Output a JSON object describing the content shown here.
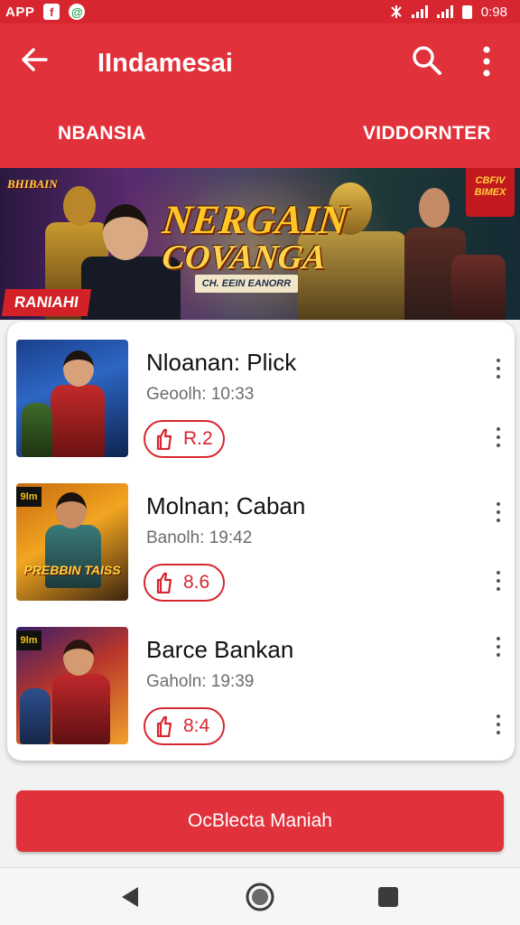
{
  "status_bar": {
    "app_label": "APP",
    "badge_1": "f",
    "badge_2": "@",
    "time": "0:98"
  },
  "app_bar": {
    "title": "IIndamesai",
    "back_icon": "arrow-left-icon",
    "search_icon": "search-icon",
    "more_icon": "more-vertical-icon"
  },
  "tabs": [
    {
      "label": "NBANSIA"
    },
    {
      "label": "VIDDORNTER"
    }
  ],
  "banner": {
    "corner_text": "BHIBAIN",
    "title_line_1": "NERGAIN",
    "title_line_2": "COVANGA",
    "subtitle": "CH. EEIN EANORR",
    "tag": "RANIAHI",
    "logo_text": "CBFIV BIMEX"
  },
  "items": [
    {
      "title": "Nloanan: Plick",
      "time": "Geoolh: 10:33",
      "score": "R.2",
      "thumb_badge": "",
      "thumb_caption": ""
    },
    {
      "title": "Molnan; Caban",
      "time": "Banolh: 19:42",
      "score": "8.6",
      "thumb_badge": "9lm",
      "thumb_caption": "PREBBIN TAISS"
    },
    {
      "title": "Barce Bankan",
      "time": "Gaholn: 19:39",
      "score": "8:4",
      "thumb_badge": "9lm",
      "thumb_caption": ""
    }
  ],
  "action_button": {
    "label": "OcBlecta Maniah"
  },
  "nav_bar": {
    "back_icon": "triangle-back-icon",
    "home_icon": "circle-home-icon",
    "recents_icon": "square-recents-icon"
  },
  "colors": {
    "primary": "#e1313b",
    "status_bar": "#d72630",
    "accent_red": "#d7262f"
  }
}
